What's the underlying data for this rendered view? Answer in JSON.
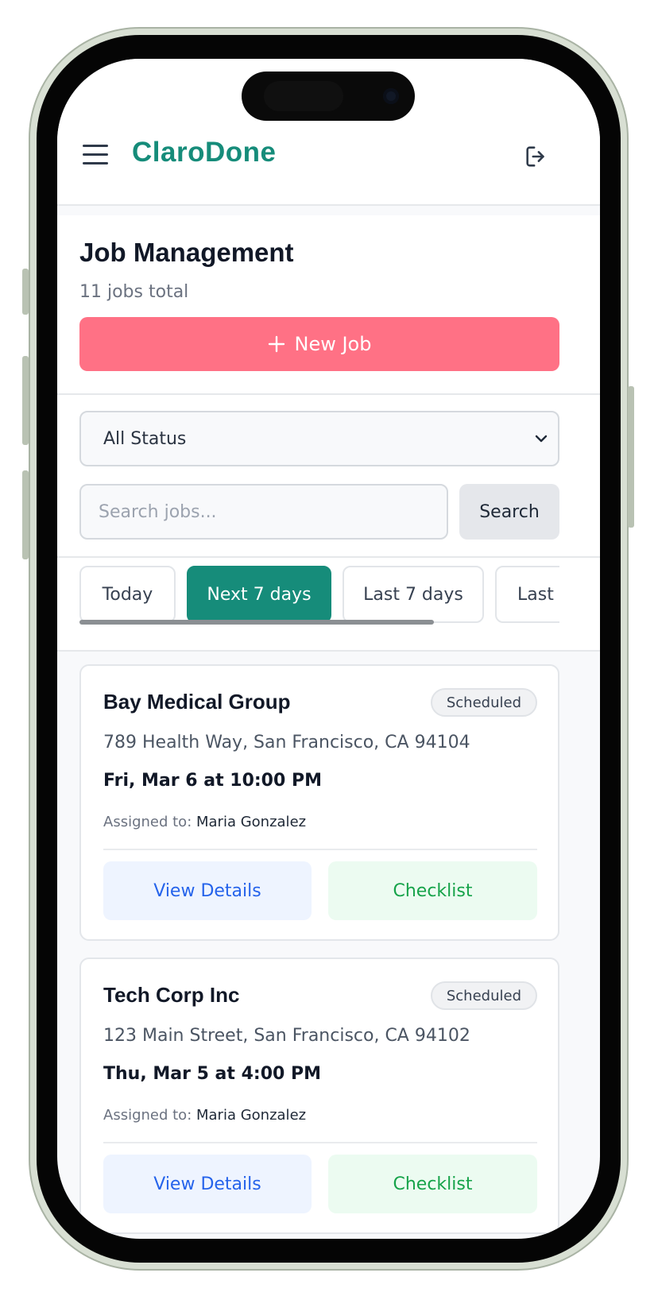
{
  "app": {
    "brand": "ClaroDone"
  },
  "icons": {
    "menu": "menu-icon",
    "logout": "logout-icon",
    "plus": "plus-icon",
    "chevron": "chevron-down-icon"
  },
  "colors": {
    "brand": "#168c7a",
    "primary_button": "#ff7185",
    "details": "#2563eb",
    "checklist": "#16a34a"
  },
  "page": {
    "title": "Job Management",
    "subtitle": "11 jobs total",
    "new_job_label": "New Job"
  },
  "filters": {
    "status_selected": "All Status",
    "search_placeholder": "Search jobs...",
    "search_label": "Search"
  },
  "tabs": [
    {
      "label": "Today",
      "active": false
    },
    {
      "label": "Next 7 days",
      "active": true
    },
    {
      "label": "Last 7 days",
      "active": false
    },
    {
      "label": "Last",
      "active": false
    }
  ],
  "jobs": [
    {
      "client": "Bay Medical Group",
      "status": "Scheduled",
      "address": "789 Health Way, San Francisco, CA 94104",
      "datetime": "Fri, Mar 6 at 10:00 PM",
      "assigned_label": "Assigned to:",
      "assignee": "Maria Gonzalez",
      "details_label": "View Details",
      "checklist_label": "Checklist"
    },
    {
      "client": "Tech Corp Inc",
      "status": "Scheduled",
      "address": "123 Main Street, San Francisco, CA 94102",
      "datetime": "Thu, Mar 5 at 4:00 PM",
      "assigned_label": "Assigned to:",
      "assignee": "Maria Gonzalez",
      "details_label": "View Details",
      "checklist_label": "Checklist"
    }
  ]
}
